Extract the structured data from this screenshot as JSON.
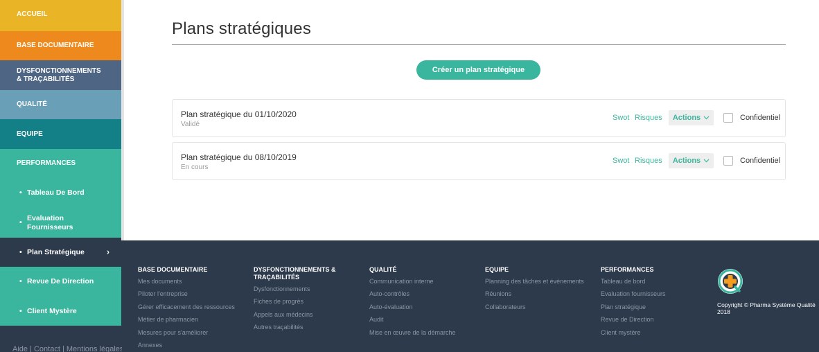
{
  "sidebar": {
    "items": [
      {
        "label": "ACCUEIL",
        "color": "#eab427"
      },
      {
        "label": "BASE DOCUMENTAIRE",
        "color": "#ee891d"
      },
      {
        "label": "DYSFONCTIONNEMENTS & TRAÇABILITÉS",
        "color": "#4f6584"
      },
      {
        "label": "QUALITÉ",
        "color": "#6a9fb8"
      },
      {
        "label": "EQUIPE",
        "color": "#137f87"
      },
      {
        "label": "PERFORMANCES",
        "color": "#3ab69e"
      }
    ],
    "subitems": [
      {
        "label": "Tableau De Bord",
        "active": false
      },
      {
        "label": "Evaluation Fournisseurs",
        "active": false
      },
      {
        "label": "Plan Stratégique",
        "active": true
      },
      {
        "label": "Revue De Direction",
        "active": false
      },
      {
        "label": "Client Mystère",
        "active": false
      }
    ],
    "bullet": "•",
    "active_chevron": "›",
    "legal": "Aide | Contact | Mentions légales"
  },
  "main": {
    "title": "Plans stratégiques",
    "create_button": "Créer un plan stratégique",
    "plans": [
      {
        "title": "Plan stratégique du 01/10/2020",
        "status": "Validé",
        "swot": "Swot",
        "risques": "Risques",
        "actions": "Actions",
        "confidential_label": "Confidentiel",
        "confidential": false
      },
      {
        "title": "Plan stratégique du 08/10/2019",
        "status": "En cours",
        "swot": "Swot",
        "risques": "Risques",
        "actions": "Actions",
        "confidential_label": "Confidentiel",
        "confidential": false
      }
    ]
  },
  "footer": {
    "columns": [
      {
        "heading": "BASE DOCUMENTAIRE",
        "links": [
          "Mes documents",
          "Piloter l'entreprise",
          "Gérer efficacement des ressources",
          "Métier de pharmacien",
          "Mesures pour s'améliorer",
          "Annexes"
        ]
      },
      {
        "heading": "DYSFONCTIONNEMENTS & TRAÇABILITÉS",
        "links": [
          "Dysfonctionnements",
          "Fiches de progrès",
          "Appels aux médecins",
          "Autres traçabilités"
        ]
      },
      {
        "heading": "QUALITÉ",
        "links": [
          "Communication interne",
          "Auto-contrôles",
          "Auto-évaluation",
          "Audit",
          "Mise en œuvre de la démarche"
        ]
      },
      {
        "heading": "EQUIPE",
        "links": [
          "Planning des tâches et évènements",
          "Réunions",
          "Collaborateurs"
        ]
      },
      {
        "heading": "PERFORMANCES",
        "links": [
          "Tableau de bord",
          "Evaluation fournisseurs",
          "Plan stratégique",
          "Revue de Direction",
          "Client mystère"
        ]
      }
    ],
    "logo_icon": "pharma-systeme-qualite-logo-icon",
    "copyright": "Copyright © Pharma Système Qualité 2018"
  },
  "colors": {
    "accent": "#3ab69e",
    "dark": "#2c3a4c",
    "footer_link": "#8c96a3"
  }
}
